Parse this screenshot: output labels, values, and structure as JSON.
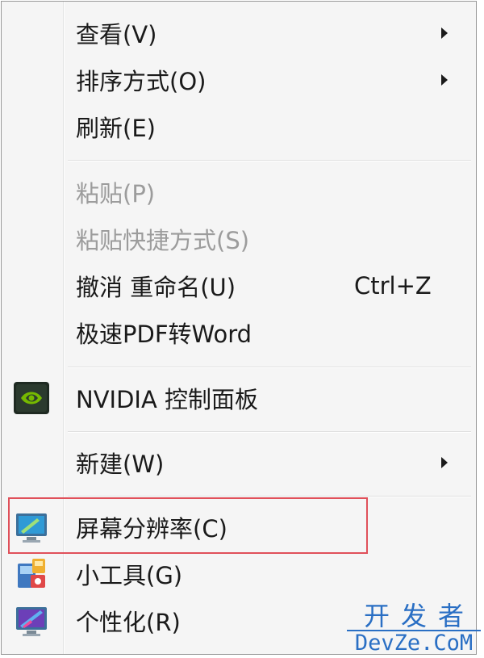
{
  "context_menu": {
    "items": [
      {
        "label": "查看(V)",
        "submenu": true
      },
      {
        "label": "排序方式(O)",
        "submenu": true
      },
      {
        "label": "刷新(E)"
      },
      {
        "label": "粘贴(P)",
        "disabled": true
      },
      {
        "label": "粘贴快捷方式(S)",
        "disabled": true
      },
      {
        "label": "撤消 重命名(U)",
        "shortcut": "Ctrl+Z"
      },
      {
        "label": "极速PDF转Word"
      },
      {
        "label": "NVIDIA 控制面板",
        "icon": "nvidia-icon"
      },
      {
        "label": "新建(W)",
        "submenu": true
      },
      {
        "label": "屏幕分辨率(C)",
        "icon": "screen-resolution-icon",
        "highlighted": true
      },
      {
        "label": "小工具(G)",
        "icon": "gadgets-icon"
      },
      {
        "label": "个性化(R)",
        "icon": "personalize-icon"
      }
    ]
  },
  "watermark": {
    "top": "开发者",
    "bottom": "DevZe.CoM"
  },
  "colors": {
    "menu_background": "#f5f5f5",
    "disabled_text": "#9c9c9c",
    "highlight_border": "#e0505a",
    "watermark": "#2a6fc4",
    "nvidia_green": "#76b900"
  }
}
